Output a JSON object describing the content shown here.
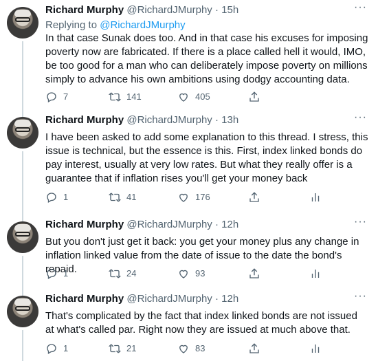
{
  "tweets": [
    {
      "author_name": "Richard Murphy",
      "handle": "@RichardJMurphy",
      "sep": "·",
      "time": "15h",
      "reply_prefix": "Replying to",
      "reply_handle": "@RichardJMurphy",
      "text": "In that case Sunak does too. And in that case his excuses for imposing poverty now are fabricated. If there is a place called hell it would, IMO, be too good for a man who can deliberately impose poverty on millions simply to advance his own ambitions using dodgy accounting data.",
      "replies": "7",
      "retweets": "141",
      "likes": "405"
    },
    {
      "author_name": "Richard Murphy",
      "handle": "@RichardJMurphy",
      "sep": "·",
      "time": "13h",
      "text": "I have been asked to add some explanation to this thread. I stress, this issue is technical, but the essence is this. First, index linked bonds do pay interest, usually at very low rates. But what they really offer is a guarantee that if inflation rises you'll get your money back",
      "replies": "1",
      "retweets": "41",
      "likes": "176"
    },
    {
      "author_name": "Richard Murphy",
      "handle": "@RichardJMurphy",
      "sep": "·",
      "time": "12h",
      "text": "But you don't just get it back: you get your money plus any change in inflation linked value from the date of issue to the date the bond's repaid.",
      "replies": "1",
      "retweets": "24",
      "likes": "93"
    },
    {
      "author_name": "Richard Murphy",
      "handle": "@RichardJMurphy",
      "sep": "·",
      "time": "12h",
      "text": "That's complicated by the fact that index linked bonds are not issued at what's called par. Right now they are issued at much above that.",
      "replies": "1",
      "retweets": "21",
      "likes": "83"
    }
  ],
  "icons": {
    "more": "more-icon",
    "reply": "reply-icon",
    "retweet": "retweet-icon",
    "like": "heart-icon",
    "share": "share-icon",
    "analytics": "analytics-icon"
  },
  "more_glyph": "···",
  "colors": {
    "text": "#0f1419",
    "secondary": "#536471",
    "link": "#1d9bf0",
    "thread_line": "#cfd9de",
    "background": "#ffffff"
  }
}
